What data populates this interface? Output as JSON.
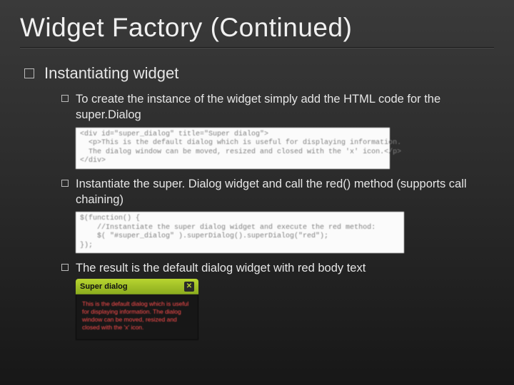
{
  "title": "Widget Factory (Continued)",
  "section": {
    "heading": "Instantiating widget"
  },
  "bullets": {
    "a": "To create the instance of the widget simply add the HTML code for the super.Dialog",
    "b": "Instantiate the super. Dialog widget and call the red() method (supports call chaining)",
    "c": "The result is the default dialog widget with red body text"
  },
  "code1": "<div id=\"super_dialog\" title=\"Super dialog\">\n  <p>This is the default dialog which is useful for displaying information.\n  The dialog window can be moved, resized and closed with the 'x' icon.</p>\n</div>",
  "code2": "$(function() {\n    //Instantiate the super dialog widget and execute the red method:\n    $( \"#super_dialog\" ).superDialog().superDialog(\"red\");\n});",
  "dialog": {
    "title": "Super dialog",
    "body": "This is the default dialog which is useful for displaying information. The dialog window can be moved, resized and closed with the 'x' icon."
  }
}
